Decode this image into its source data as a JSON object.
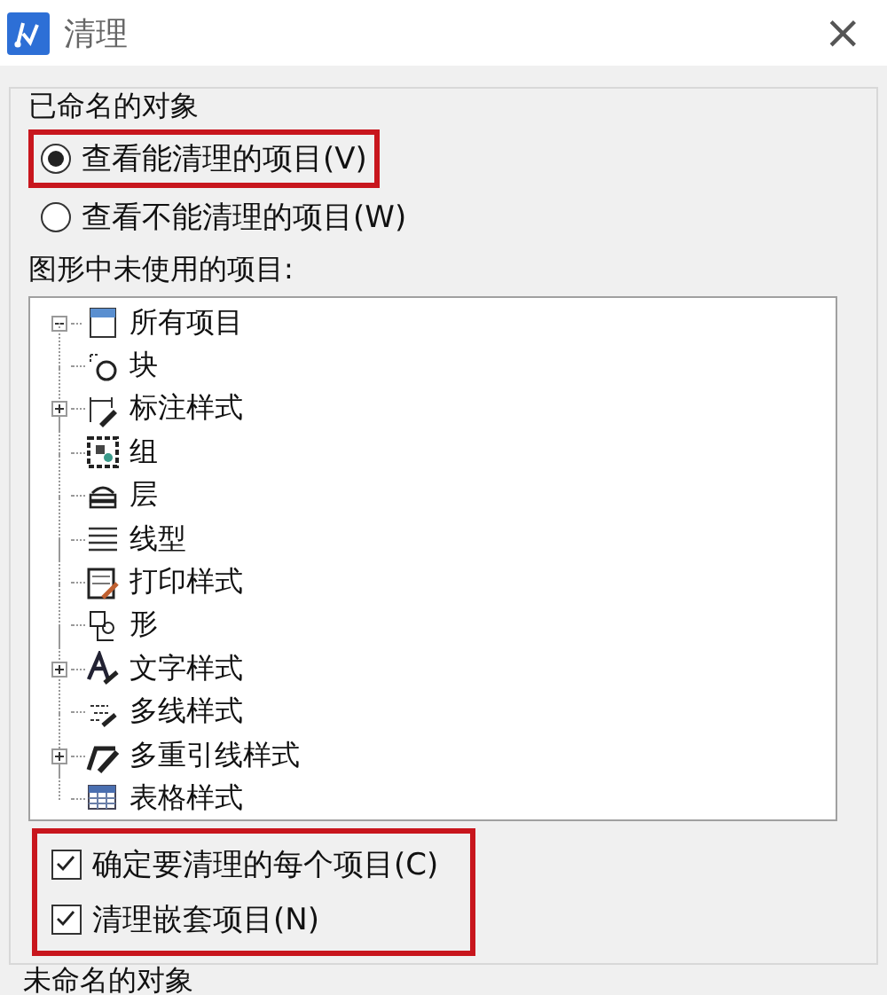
{
  "window": {
    "title": "清理",
    "close": "×"
  },
  "named_group": {
    "title": "已命名的对象",
    "radios": [
      {
        "label": "查看能清理的项目(V)",
        "selected": true,
        "highlighted": true
      },
      {
        "label": "查看不能清理的项目(W)",
        "selected": false,
        "highlighted": false
      }
    ],
    "tree_label": "图形中未使用的项目:",
    "tree": {
      "label": "所有项目",
      "expanded": true,
      "children": [
        {
          "label": "块",
          "kind": "block",
          "expandable": false
        },
        {
          "label": "标注样式",
          "kind": "dim",
          "expandable": true
        },
        {
          "label": "组",
          "kind": "group",
          "expandable": false
        },
        {
          "label": "层",
          "kind": "layer",
          "expandable": false
        },
        {
          "label": "线型",
          "kind": "linetype",
          "expandable": false
        },
        {
          "label": "打印样式",
          "kind": "plot",
          "expandable": false
        },
        {
          "label": "形",
          "kind": "shape",
          "expandable": false
        },
        {
          "label": "文字样式",
          "kind": "text",
          "expandable": true
        },
        {
          "label": "多线样式",
          "kind": "mline",
          "expandable": false
        },
        {
          "label": "多重引线样式",
          "kind": "mleader",
          "expandable": true
        },
        {
          "label": "表格样式",
          "kind": "table",
          "expandable": false
        }
      ]
    },
    "checkboxes_highlighted": true,
    "checkboxes": [
      {
        "label": "确定要清理的每个项目(C)",
        "checked": true
      },
      {
        "label": "清理嵌套项目(N)",
        "checked": true
      }
    ]
  },
  "unnamed_group": {
    "title": "未命名的对象"
  }
}
